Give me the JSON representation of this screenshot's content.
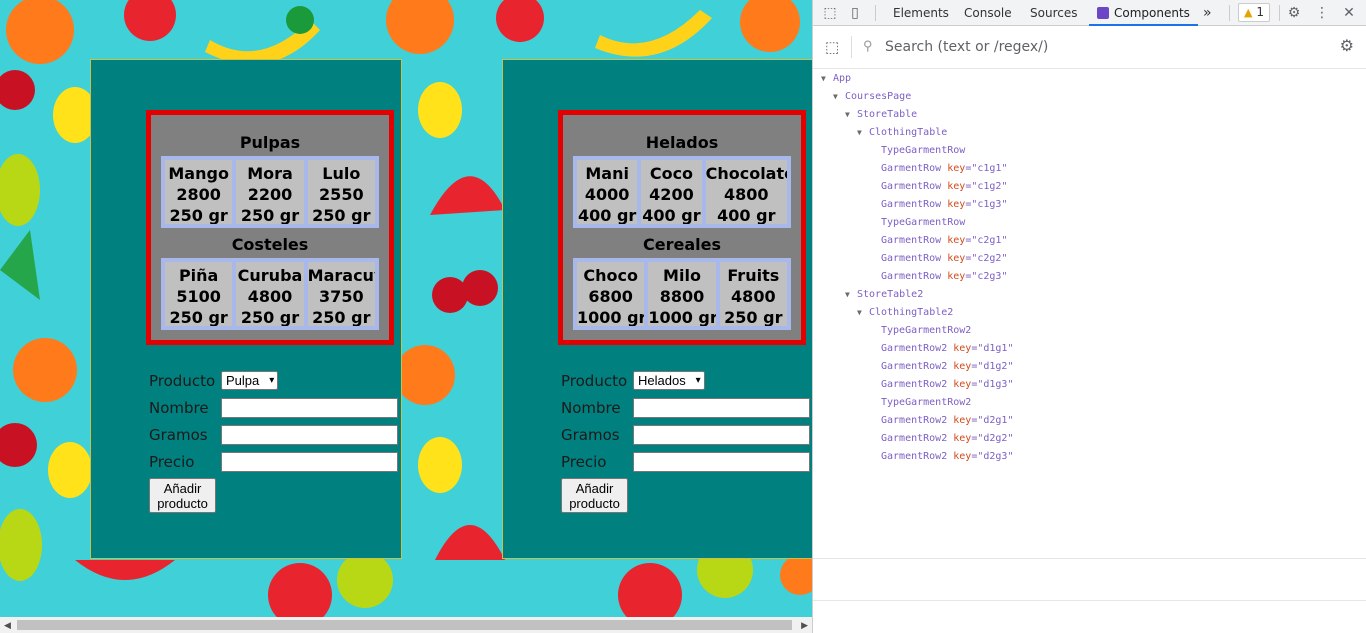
{
  "stores": [
    {
      "categories": [
        {
          "title": "Pulpas",
          "items": [
            {
              "name": "Mango",
              "price": "2800",
              "weight": "250 gr"
            },
            {
              "name": "Mora",
              "price": "2200",
              "weight": "250 gr"
            },
            {
              "name": "Lulo",
              "price": "2550",
              "weight": "250 gr"
            }
          ]
        },
        {
          "title": "Costeles",
          "items": [
            {
              "name": "Piña",
              "price": "5100",
              "weight": "250 gr"
            },
            {
              "name": "Curuba",
              "price": "4800",
              "weight": "250 gr"
            },
            {
              "name": "Maracuyá",
              "price": "3750",
              "weight": "250 gr"
            }
          ]
        }
      ],
      "form": {
        "producto_label": "Producto",
        "producto_value": "Pulpa",
        "nombre_label": "Nombre",
        "gramos_label": "Gramos",
        "precio_label": "Precio",
        "button_line1": "Añadir",
        "button_line2": "producto"
      }
    },
    {
      "categories": [
        {
          "title": "Helados",
          "items": [
            {
              "name": "Mani",
              "price": "4000",
              "weight": "400 gr"
            },
            {
              "name": "Coco",
              "price": "4200",
              "weight": "400 gr"
            },
            {
              "name": "Chocolate",
              "price": "4800",
              "weight": "400 gr"
            }
          ]
        },
        {
          "title": "Cereales",
          "items": [
            {
              "name": "Choco",
              "price": "6800",
              "weight": "1000 gr"
            },
            {
              "name": "Milo",
              "price": "8800",
              "weight": "1000 gr"
            },
            {
              "name": "Fruits",
              "price": "4800",
              "weight": "250 gr"
            }
          ]
        }
      ],
      "form": {
        "producto_label": "Producto",
        "producto_value": "Helados",
        "nombre_label": "Nombre",
        "gramos_label": "Gramos",
        "precio_label": "Precio",
        "button_line1": "Añadir",
        "button_line2": "producto"
      }
    }
  ],
  "devtools": {
    "tabs": [
      "Elements",
      "Console",
      "Sources",
      "Components"
    ],
    "active_tab": "Components",
    "more_tabs": "»",
    "warning_count": "1",
    "search_placeholder": "Search (text or /regex/)",
    "accent": "#1a73e8",
    "tree": [
      {
        "depth": 0,
        "name": "App",
        "expanded": true
      },
      {
        "depth": 1,
        "name": "CoursesPage",
        "expanded": true
      },
      {
        "depth": 2,
        "name": "StoreTable",
        "expanded": true
      },
      {
        "depth": 3,
        "name": "ClothingTable",
        "expanded": true
      },
      {
        "depth": 4,
        "name": "TypeGarmentRow"
      },
      {
        "depth": 4,
        "name": "GarmentRow",
        "key": "c1g1"
      },
      {
        "depth": 4,
        "name": "GarmentRow",
        "key": "c1g2"
      },
      {
        "depth": 4,
        "name": "GarmentRow",
        "key": "c1g3"
      },
      {
        "depth": 4,
        "name": "TypeGarmentRow"
      },
      {
        "depth": 4,
        "name": "GarmentRow",
        "key": "c2g1"
      },
      {
        "depth": 4,
        "name": "GarmentRow",
        "key": "c2g2"
      },
      {
        "depth": 4,
        "name": "GarmentRow",
        "key": "c2g3"
      },
      {
        "depth": 2,
        "name": "StoreTable2",
        "expanded": true
      },
      {
        "depth": 3,
        "name": "ClothingTable2",
        "expanded": true
      },
      {
        "depth": 4,
        "name": "TypeGarmentRow2"
      },
      {
        "depth": 4,
        "name": "GarmentRow2",
        "key": "d1g1"
      },
      {
        "depth": 4,
        "name": "GarmentRow2",
        "key": "d1g2"
      },
      {
        "depth": 4,
        "name": "GarmentRow2",
        "key": "d1g3"
      },
      {
        "depth": 4,
        "name": "TypeGarmentRow2"
      },
      {
        "depth": 4,
        "name": "GarmentRow2",
        "key": "d2g1"
      },
      {
        "depth": 4,
        "name": "GarmentRow2",
        "key": "d2g2"
      },
      {
        "depth": 4,
        "name": "GarmentRow2",
        "key": "d2g3"
      }
    ]
  }
}
